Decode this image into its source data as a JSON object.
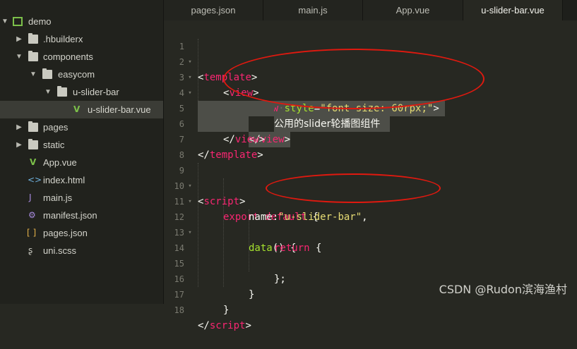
{
  "sidebar": {
    "items": [
      {
        "label": "demo",
        "icon": "project-icon"
      },
      {
        "label": ".hbuilderx",
        "icon": "folder-icon"
      },
      {
        "label": "components",
        "icon": "folder-icon"
      },
      {
        "label": "easycom",
        "icon": "folder-icon"
      },
      {
        "label": "u-slider-bar",
        "icon": "folder-icon"
      },
      {
        "label": "u-slider-bar.vue",
        "icon": "vue-file-icon"
      },
      {
        "label": "pages",
        "icon": "folder-icon"
      },
      {
        "label": "static",
        "icon": "folder-icon"
      },
      {
        "label": "App.vue",
        "icon": "vue-file-icon"
      },
      {
        "label": "index.html",
        "icon": "html-file-icon"
      },
      {
        "label": "main.js",
        "icon": "js-file-icon"
      },
      {
        "label": "manifest.json",
        "icon": "manifest-file-icon"
      },
      {
        "label": "pages.json",
        "icon": "json-file-icon"
      },
      {
        "label": "uni.scss",
        "icon": "scss-file-icon"
      }
    ]
  },
  "tabs": [
    {
      "label": "pages.json"
    },
    {
      "label": "main.js"
    },
    {
      "label": "App.vue"
    },
    {
      "label": "u-slider-bar.vue"
    }
  ],
  "code": {
    "line_numbers": [
      "1",
      "2",
      "3",
      "4",
      "5",
      "6",
      "7",
      "8",
      "9",
      "10",
      "11",
      "12",
      "13",
      "14",
      "15",
      "16",
      "17",
      "18"
    ],
    "l1": {
      "open": "<",
      "name": "template",
      "close": ">"
    },
    "l2": {
      "open": "<",
      "name": "view",
      "close": ">"
    },
    "l3": {
      "open": "<",
      "name": "view",
      "attr": "style",
      "eq": "=",
      "value": "\"font-size: 60rpx;\"",
      "close": ">"
    },
    "l4": {
      "text": "公用的slider轮播图组件"
    },
    "l5": {
      "open": "</",
      "name": "view",
      "close": ">"
    },
    "l6": {
      "open": "</",
      "name": "view",
      "close": ">"
    },
    "l7": {
      "open": "</",
      "name": "template",
      "close": ">"
    },
    "l9": {
      "open": "<",
      "name": "script",
      "close": ">"
    },
    "l10": {
      "kw1": "export",
      "kw2": "default",
      "brace": "{"
    },
    "l11": {
      "key": "name",
      "colon": ":",
      "value": "\"u-slider-bar\"",
      "comma": ","
    },
    "l12": {
      "fn": "data",
      "paren": "()",
      "brace": "{"
    },
    "l13": {
      "kw": "return",
      "brace": "{"
    },
    "l15": {
      "text": "};"
    },
    "l16": {
      "text": "}"
    },
    "l17": {
      "text": "}"
    },
    "l18": {
      "open": "</",
      "name": "script",
      "close": ">"
    }
  },
  "watermark": "CSDN @Rudon滨海渔村",
  "colors": {
    "tag": "#f92672",
    "attr": "#a6e22e",
    "string": "#e6db74",
    "annotation": "#e0190f"
  }
}
